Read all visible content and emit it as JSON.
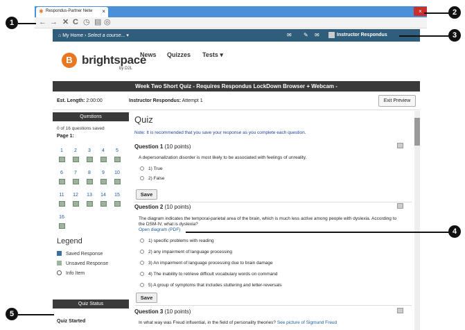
{
  "browser": {
    "tab_title": "Respondus-Partner Netw",
    "tab_close": "×",
    "close": "×",
    "nav_back": "←",
    "nav_forward": "→",
    "nav_stop": "✕",
    "nav_reload": "C"
  },
  "minibar": {
    "home": "My Home",
    "select": "Select a course...",
    "user": "Instructor Respondus"
  },
  "header": {
    "brand": "brightspace",
    "by": "by D2L",
    "logo": "B",
    "nav": [
      "News",
      "Quizzes",
      "Tests"
    ]
  },
  "quiz": {
    "banner": "Week Two Short Quiz - Requires Respondus LockDown Browser + Webcam -",
    "est_label": "Est. Length:",
    "est_value": "2:00:00",
    "attempt_label": "Instructor Respondus:",
    "attempt_value": "Attempt 1",
    "exit": "Exit Preview"
  },
  "left": {
    "questions_header": "Questions",
    "saved": "0 of 16 questions saved",
    "page": "Page 1:",
    "legend": "Legend",
    "legend_items": [
      "Saved Response",
      "Unsaved Response",
      "Info Item"
    ],
    "status_header": "Quiz Status",
    "status": "Quiz Started",
    "numbers": [
      "1",
      "2",
      "3",
      "4",
      "5",
      "6",
      "7",
      "8",
      "9",
      "10",
      "11",
      "12",
      "13",
      "14",
      "15",
      "16"
    ]
  },
  "main": {
    "title": "Quiz",
    "note": "Note: It is recommended that you save your response as you complete each question.",
    "q1": {
      "label": "Question 1",
      "points": "(10 points)",
      "text": "A depersonalization disorder is most likely to be associated with feelings of unreality.",
      "options": [
        "1) True",
        "2) False"
      ]
    },
    "save": "Save",
    "q2": {
      "label": "Question 2",
      "points": "(10 points)",
      "text": "The diagram indicates the temporal-parietal area of the brain, which is much less active among people with dyslexia. According to the DSM-IV, what is dyslexia?",
      "link": "Open diagram (PDF)",
      "options": [
        "1) specific problems with reading",
        "2) any impairment of language processing",
        "3) An impairment of language processing due to brain damage",
        "4) The inability to retrieve difficult vocabulary words on command",
        "5) A group of symptoms that includes stuttering and letter-reversals"
      ]
    },
    "q3": {
      "label": "Question 3",
      "points": "(10 points)",
      "text": "In what way was Freud influential, in the field of personality theories?",
      "link": "See picture of Sigmund Freud"
    }
  },
  "callouts": [
    "1",
    "2",
    "3",
    "4",
    "5"
  ]
}
